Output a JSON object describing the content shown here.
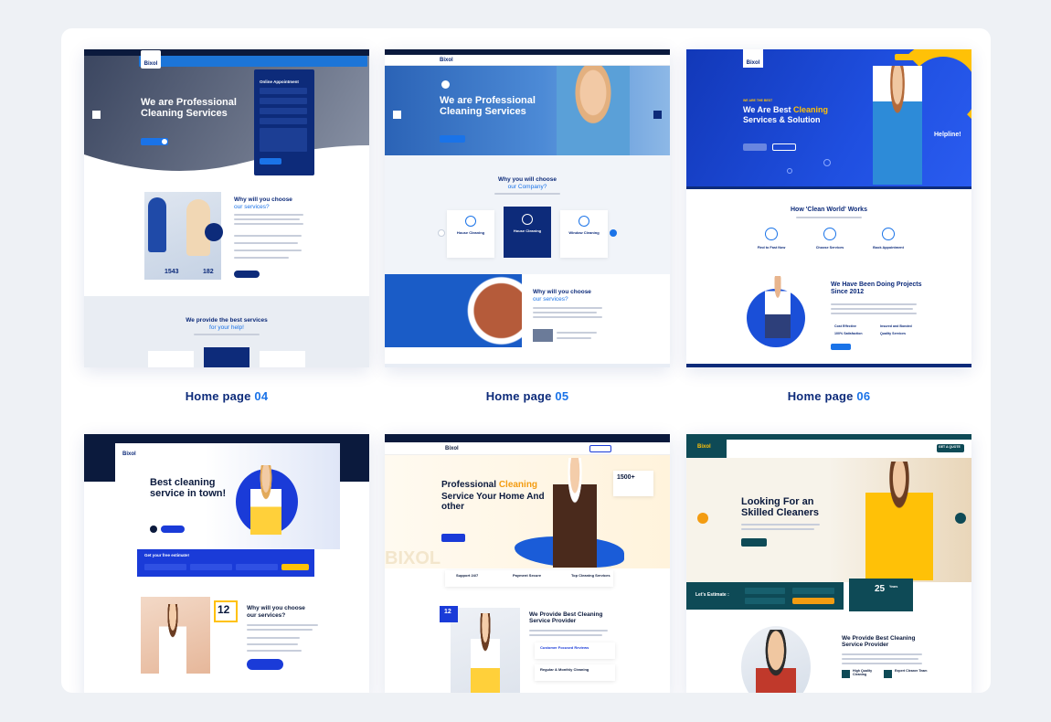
{
  "captions": [
    {
      "prefix": "Home page",
      "number": "04"
    },
    {
      "prefix": "Home page",
      "number": "05"
    },
    {
      "prefix": "Home page",
      "number": "06"
    }
  ],
  "demo1": {
    "logo": "Bixol",
    "hero_title": "We are Professional Cleaning Services",
    "form_title": "Online Appointment",
    "section_title_a": "Why will you choose",
    "section_title_b": "our services?",
    "stat1": "1543",
    "stat2": "182",
    "bottom_title_a": "We provide the best services",
    "bottom_title_b": "for your help!"
  },
  "demo2": {
    "logo": "Bixol",
    "hero_title": "We are Professional Cleaning Services",
    "section_title_a": "Why you will choose",
    "section_title_b": "our Company?",
    "services": [
      "House Cleaning",
      "House Cleaning",
      "Window Cleaning"
    ],
    "why_title_a": "Why will you choose",
    "why_title_b": "our services?"
  },
  "demo3": {
    "logo": "Bixol",
    "eyebrow": "WE ARE THE BEST",
    "hero_title_a": "We Are Best",
    "hero_title_hl": "Cleaning",
    "hero_title_b": "Services & Solution",
    "helpline": "Helpline!",
    "works_title": "How 'Clean World' Works",
    "steps": [
      "Find to Fast Now",
      "Choose Services",
      "Book Appointment"
    ],
    "projects_title": "We Have Been Doing Projects Since 2012",
    "checks": [
      "Cost Effective",
      "Insured and Bonded",
      "100% Satisfaction",
      "Quality Services"
    ]
  },
  "demo4": {
    "logo": "Bixol",
    "hero_title": "Best cleaning service in town!",
    "estimate_title": "Get your free estimate!",
    "badge_number": "12",
    "section_title_a": "Why will you choose",
    "section_title_b": "our services?"
  },
  "demo5": {
    "logo": "Bixol",
    "hero_title_a": "Professional",
    "hero_title_hl": "Cleaning",
    "hero_title_b": "Service Your Home And other",
    "stat": "1500+",
    "watermark": "BIXOL",
    "features": [
      "Support 24/7",
      "Payment Secure",
      "Top Cleaning Services"
    ],
    "badge_number": "12",
    "section_title": "We Provide Best Cleaning Service Provider",
    "list": [
      "Customer Focused Reviews",
      "Regular & Monthly Cleaning"
    ]
  },
  "demo6": {
    "logo": "Bixol",
    "hero_title": "Looking For an Skilled Cleaners",
    "estimate_label": "Let's Estimate :",
    "years": "25",
    "years_label": "Years",
    "section_title": "We Provide Best Cleaning Service Provider",
    "features": [
      "High Quality Cleaning",
      "Expert Cleaner Team"
    ],
    "cta": "GET A QUOTE"
  },
  "colors": {
    "navy": "#0d2b7a",
    "blue": "#1a73e8",
    "yellow": "#ffc107",
    "orange": "#f39c12",
    "teal": "#0e4a56",
    "dark": "#0b1a3d"
  }
}
